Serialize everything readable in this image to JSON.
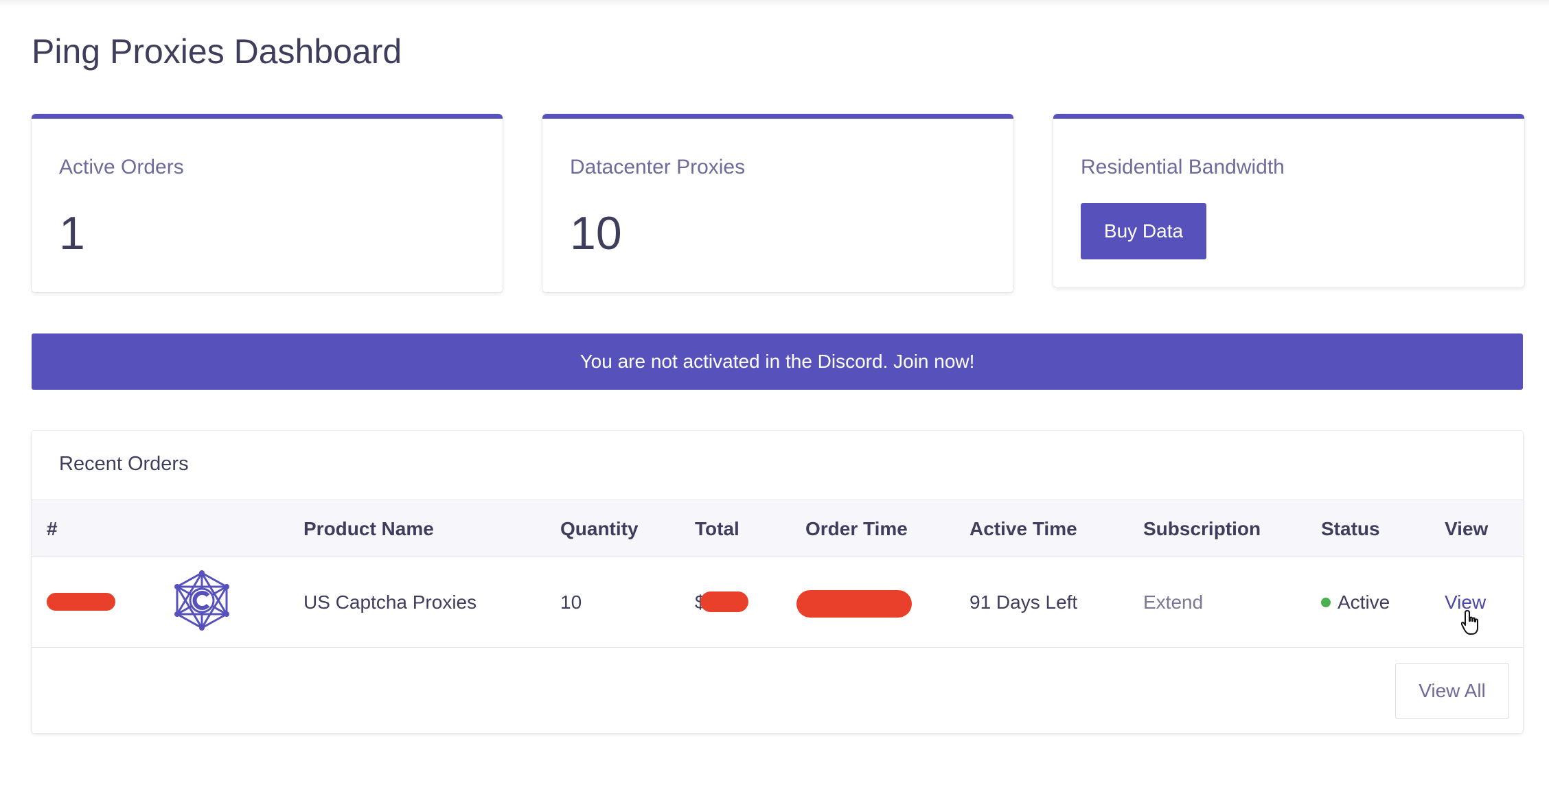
{
  "page": {
    "title": "Ping Proxies Dashboard"
  },
  "stats": [
    {
      "label": "Active Orders",
      "value": "1"
    },
    {
      "label": "Datacenter Proxies",
      "value": "10"
    },
    {
      "label": "Residential Bandwidth",
      "button": "Buy Data"
    }
  ],
  "banner": {
    "text": "You are not activated in the Discord. Join now!"
  },
  "orders": {
    "title": "Recent Orders",
    "columns": [
      "#",
      "Product Name",
      "Quantity",
      "Total",
      "Order Time",
      "Active Time",
      "Subscription",
      "Status",
      "View"
    ],
    "rows": [
      {
        "id": "",
        "product_icon": "captcha-network-icon",
        "product_name": "US Captcha Proxies",
        "quantity": "10",
        "total_prefix": "$",
        "order_time": "",
        "active_time": "91 Days Left",
        "subscription": "Extend",
        "status": "Active",
        "view": "View"
      }
    ],
    "view_all": "View All"
  },
  "colors": {
    "accent": "#5651bb",
    "status_active": "#4caf50",
    "redaction": "#e8402a"
  }
}
